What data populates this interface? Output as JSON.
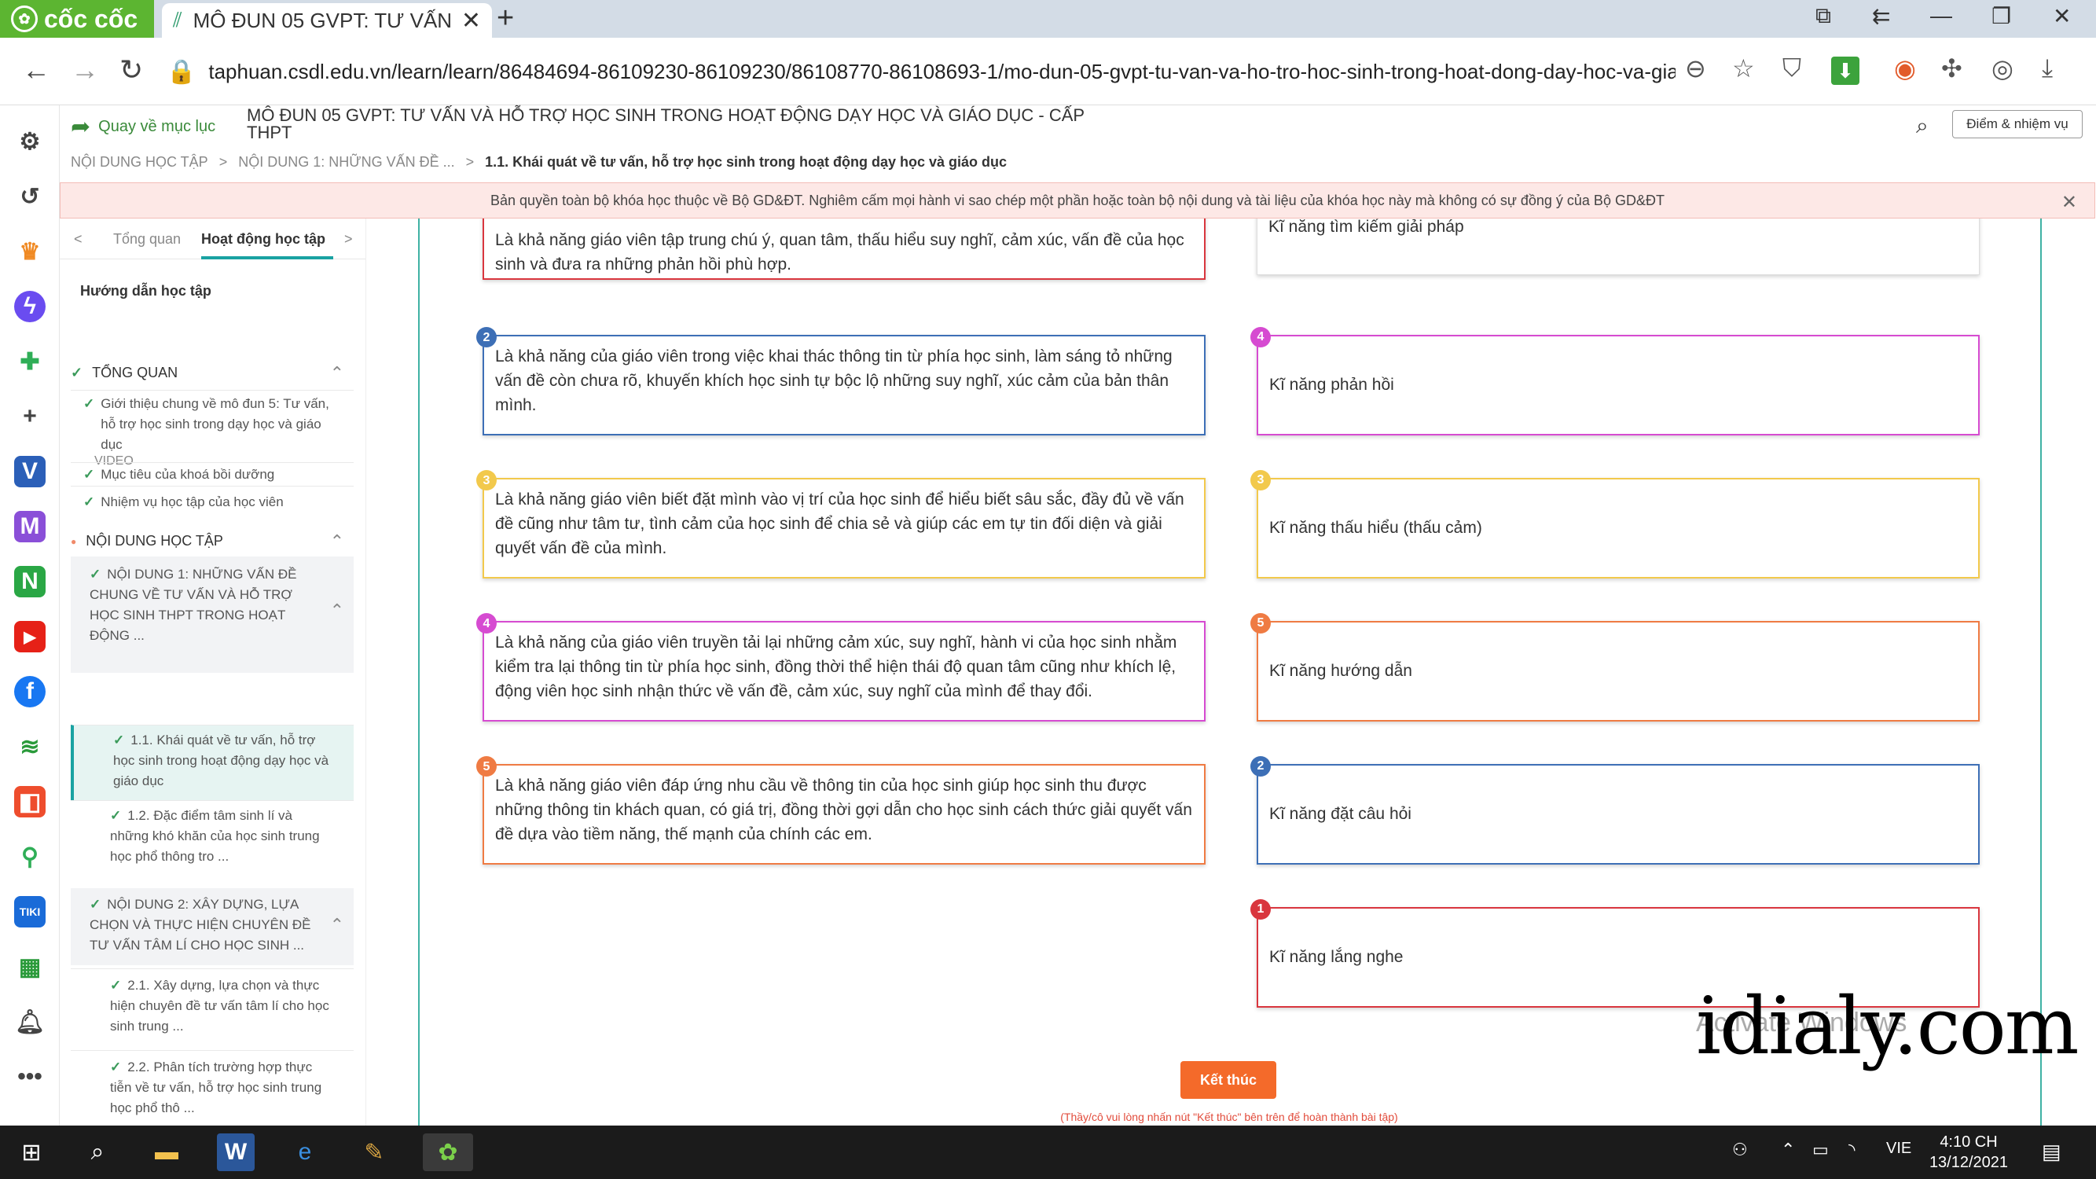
{
  "browser": {
    "brand": "cốc cốc",
    "tab_title": "MÔ ĐUN 05 GVPT: TƯ VẤN V",
    "url": "taphuan.csdl.edu.vn/learn/learn/86484694-86109230-86109230/86108770-86108693-1/mo-dun-05-gvpt-tu-van-va-ho-tro-hoc-sinh-trong-hoat-dong-day-hoc-va-giao-d..."
  },
  "header": {
    "back_label": "Quay về mục lục",
    "course_title": "MÔ ĐUN 05 GVPT: TƯ VẤN VÀ HỖ TRỢ HỌC SINH TRONG HOẠT ĐỘNG DẠY HỌC VÀ GIÁO DỤC - CẤP THPT",
    "score_button": "Điểm & nhiệm vụ"
  },
  "breadcrumb": {
    "items": [
      "NỘI DUNG HỌC TẬP",
      "NỘI DUNG 1: NHỮNG VẤN ĐỀ ..."
    ],
    "separator": ">",
    "current": "1.1. Khái quát về tư vấn, hỗ trợ học sinh trong hoạt động dạy học và giáo dục"
  },
  "notice": "Bản quyền toàn bộ khóa học thuộc về Bộ GD&ĐT. Nghiêm cấm mọi hành vi sao chép một phần hoặc toàn bộ nội dung và tài liệu của khóa học này mà không có sự đồng ý của Bộ GD&ĐT",
  "sidebar": {
    "tab_prev": "<",
    "tab_next": ">",
    "tabs": [
      "Tổng quan",
      "Hoạt động học tập"
    ],
    "guide": "Hướng dẫn học tập",
    "section1": "TỔNG QUAN",
    "overview_items": [
      {
        "text": "Giới thiệu chung về mô đun 5: Tư vấn, hỗ trợ học sinh trong dạy học và giáo dục",
        "tag": "VIDEO"
      },
      {
        "text": "Mục tiêu của khoá bồi dưỡng"
      },
      {
        "text": "Nhiệm vụ học tập của học viên"
      }
    ],
    "section2": "NỘI DUNG HỌC TẬP",
    "group1": "NỘI DUNG 1: NHỮNG VẤN ĐỀ CHUNG VỀ TƯ VẤN VÀ HỖ TRỢ HỌC SINH THPT TRONG HOẠT ĐỘNG ...",
    "group1_items": [
      "1.1. Khái quát về tư vấn, hỗ trợ học sinh trong hoạt động dạy học và giáo dục",
      "1.2. Đặc điểm tâm sinh lí và những khó khăn của học sinh trung học phổ thông tro ..."
    ],
    "group2": "NỘI DUNG 2: XÂY DỰNG, LỰA CHỌN VÀ THỰC HIỆN CHUYÊN ĐỀ TƯ VẤN TÂM LÍ CHO HỌC SINH ...",
    "group2_items": [
      "2.1. Xây dựng, lựa chọn và thực hiện chuyên đề tư vấn tâm lí cho học sinh trung ...",
      "2.2. Phân tích trường hợp thực tiễn về tư vấn, hỗ trợ học sinh trung học phổ thô ..."
    ]
  },
  "exercise": {
    "left_cards": [
      {
        "num": "",
        "color": "#d9363e",
        "text": "Là khả năng giáo viên tập trung chú ý, quan tâm, thấu hiểu suy nghĩ, cảm xúc, vấn đề của học sinh và đưa ra những phản hồi phù hợp."
      },
      {
        "num": "2",
        "color": "#3d6fb6",
        "text": "Là khả năng của giáo viên trong việc khai thác thông tin từ phía học sinh, làm sáng tỏ những vấn đề còn chưa rõ, khuyến khích học sinh tự bộc lộ những suy nghĩ, xúc cảm của bản thân mình."
      },
      {
        "num": "3",
        "color": "#f2c94c",
        "text": "Là khả năng giáo viên biết đặt mình vào vị trí của học sinh để hiểu biết sâu sắc, đầy đủ về vấn đề cũng như tâm tư, tình cảm của học sinh để chia sẻ và giúp các em tự tin đối diện và giải quyết vấn đề của mình."
      },
      {
        "num": "4",
        "color": "#d64bd1",
        "text": "Là khả năng của giáo viên truyền tải lại những cảm xúc, suy nghĩ, hành vi của học sinh nhằm kiểm tra lại thông tin từ phía học sinh, đồng thời thể hiện thái độ quan tâm cũng như khích lệ, động viên học sinh nhận thức về vấn đề, cảm xúc, suy nghĩ của mình để thay đổi."
      },
      {
        "num": "5",
        "color": "#ef7b43",
        "text": "Là khả năng giáo viên đáp ứng nhu cầu về thông tin của học sinh giúp học sinh thu được những thông tin khách quan, có giá trị, đồng thời gợi dẫn cho học sinh cách thức giải quyết vấn đề dựa vào tiềm năng, thế mạnh của chính các em."
      }
    ],
    "right_cards": [
      {
        "num": "",
        "color": "#dddddd",
        "text": "Kĩ năng tìm kiếm giải pháp"
      },
      {
        "num": "4",
        "color": "#d64bd1",
        "text": "Kĩ năng phản hồi"
      },
      {
        "num": "3",
        "color": "#f2c94c",
        "text": "Kĩ năng thấu hiểu (thấu cảm)"
      },
      {
        "num": "5",
        "color": "#ef7b43",
        "text": "Kĩ năng hướng dẫn"
      },
      {
        "num": "2",
        "color": "#3d6fb6",
        "text": "Kĩ năng đặt câu hỏi"
      },
      {
        "num": "1",
        "color": "#d9363e",
        "text": "Kĩ năng lắng nghe"
      }
    ],
    "finish_button": "Kết thúc",
    "hint": "(Thầy/cô vui lòng nhấn nút \"Kết thúc\" bên trên để hoàn thành bài tập)"
  },
  "overlay": {
    "watermark": "idialy.com",
    "activate": "Activate Windows"
  },
  "taskbar": {
    "language": "VIE",
    "time": "4:10 CH",
    "date": "13/12/2021"
  }
}
